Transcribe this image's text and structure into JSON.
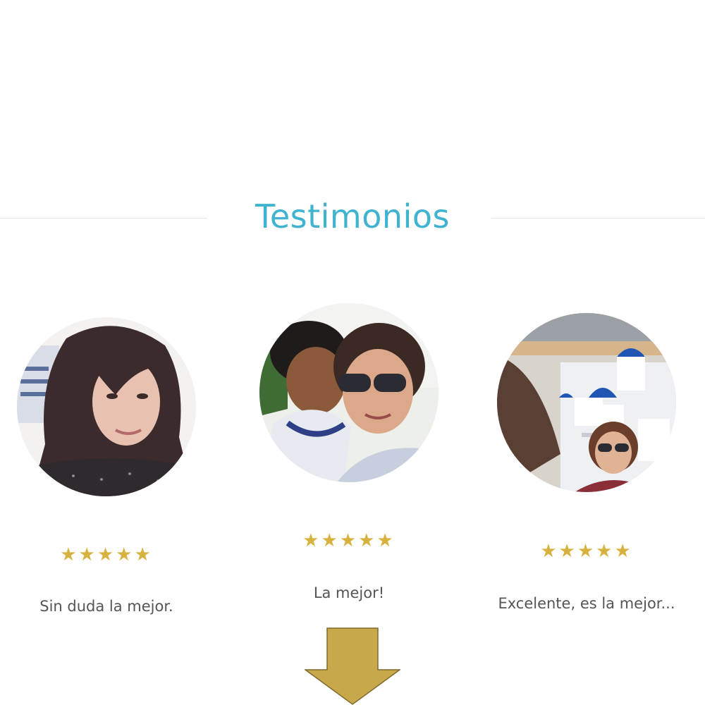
{
  "section": {
    "title": "Testimonios"
  },
  "colors": {
    "title": "#3fb3cf",
    "stars": "#d8b23f",
    "quote_text": "#555555",
    "arrow_fill": "#c8a84a",
    "arrow_stroke": "#7d6c2e"
  },
  "testimonials": [
    {
      "rating": 5,
      "stars_text": "★★★★★",
      "quote": "Sin duda la mejor."
    },
    {
      "rating": 5,
      "stars_text": "★★★★★",
      "quote": "La mejor!"
    },
    {
      "rating": 5,
      "stars_text": "★★★★★",
      "quote": "Excelente, es la mejor..."
    }
  ],
  "scroll_indicator": {
    "icon": "down-arrow-icon"
  }
}
